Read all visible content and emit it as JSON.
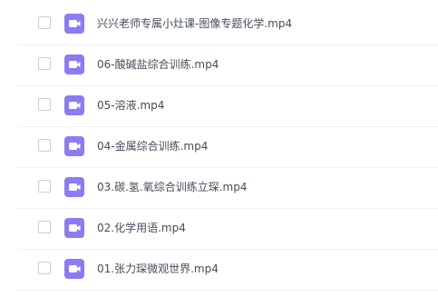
{
  "files": [
    {
      "name": "兴兴老师专属小灶课-图像专题化学.mp4",
      "icon": "video-file-icon"
    },
    {
      "name": "06-酸碱盐综合训练.mp4",
      "icon": "video-file-icon"
    },
    {
      "name": "05-溶液.mp4",
      "icon": "video-file-icon"
    },
    {
      "name": "04-金属综合训练.mp4",
      "icon": "video-file-icon"
    },
    {
      "name": "03.碳.氢.氧综合训练立琛.mp4",
      "icon": "video-file-icon"
    },
    {
      "name": "02.化学用语.mp4",
      "icon": "video-file-icon"
    },
    {
      "name": "01.张力琛微观世界.mp4",
      "icon": "video-file-icon"
    }
  ],
  "colors": {
    "icon_background": "#8a7cf5",
    "text": "#454d5a",
    "divider": "#eef0f3",
    "checkbox_border": "#c9cdd4"
  }
}
